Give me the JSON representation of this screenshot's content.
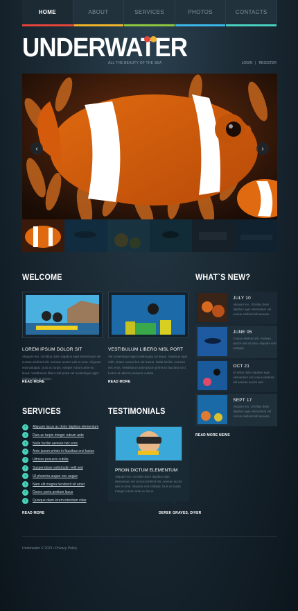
{
  "nav": {
    "items": [
      "HOME",
      "ABOUT",
      "SERVICES",
      "PHOTOS",
      "CONTACTS"
    ],
    "bar_colors": [
      "#e4443a",
      "#f0b429",
      "#8cc63f",
      "#3bb7e8",
      "#49d1c0"
    ]
  },
  "header": {
    "logo": "UNDERWATER",
    "tagline": "ALL THE BEAUTY OF THE SEA",
    "login": "LOGIN",
    "separator": "|",
    "register": "REGISTER",
    "dot_colors": [
      "#e4443a",
      "#f0b429"
    ]
  },
  "slider": {
    "prev": "‹",
    "next": "›"
  },
  "welcome": {
    "heading": "WELCOME",
    "cards": [
      {
        "title": "LOREM IPSUM DOLOR SIT",
        "text": "Aliquam leo. Ut tellus dolor dapibus eget elementum vel cursus eleifend elit. Aenean auctor wisi et urna. Aliquam erat volutpat. Duis ac turpis. Integer rutrum ante eu lacus. Vestibulum libero nisl porta vel scelerisque eget malesuada at neque.",
        "more": "READ MORE"
      },
      {
        "title": "VESTIBULUM LIBERO NISL PORT",
        "text": "Vel scelerisque eget malesuada at neque. Vivamus eget nibh. Etiam cursus leo vel metus. Nulla facilisi. Aenean nec eros. Vestibulum ante ipsum primis in faucibus orci luctus et ultrices posuere cubilia.",
        "more": "READ MORE"
      }
    ]
  },
  "news": {
    "heading": "WHAT`S NEW?",
    "items": [
      {
        "date": "JULY 10",
        "text": "Aliquam leo. Ut tellus dolor dapibus eget elementum vel cursus eleifend elit aenean."
      },
      {
        "date": "JUNE 05",
        "text": "Cursus eleifend elit. Aenean auctor wisi et urna. Aliquam erat volutpat."
      },
      {
        "date": "OCT 21",
        "text": "Ut tellus dolor dapibus eget elementum vel cursus eleifend elit aenean auctor wisi."
      },
      {
        "date": "SEPT 17",
        "text": "Aliquam leo. Ut tellus dolor dapibus eget elementum vel cursus eleifend elit aenean."
      }
    ],
    "more": "READ MORE NEWS"
  },
  "services": {
    "heading": "SERVICES",
    "items": [
      "Aliquam lacus ac dolor dapibus elementum",
      "Duis ac turpis integer rutrum ante",
      "Nulla facilisi aenean nec eros",
      "Ante ipsum primis in faucibus orci luctus",
      "Ultrices posuere cubilia",
      "Suspendisse sollicitudin velit sed",
      "Ut pharetra augue nec augue",
      "Nam elit magna hendrerit sit amet",
      "Donec porta pretium lacus",
      "Quisque diam lorem interdum vitae"
    ],
    "more": "READ MORE"
  },
  "testimonials": {
    "heading": "TESTIMONIALS",
    "title": "PROIN DICTUM ELEMENTUM",
    "text": "Aliquam leo. Ut tellus dolor dapibus eget elementum vel cursus eleifend elit. Aenean auctor wisi et urna. Aliquam erat volutpat. Duis ac turpis. Integer rutrum ante eu lacus.",
    "author": "DEREK GRAVES, DIVER"
  },
  "footer": {
    "text": "Underwater © 2013 • Privacy Policy"
  }
}
